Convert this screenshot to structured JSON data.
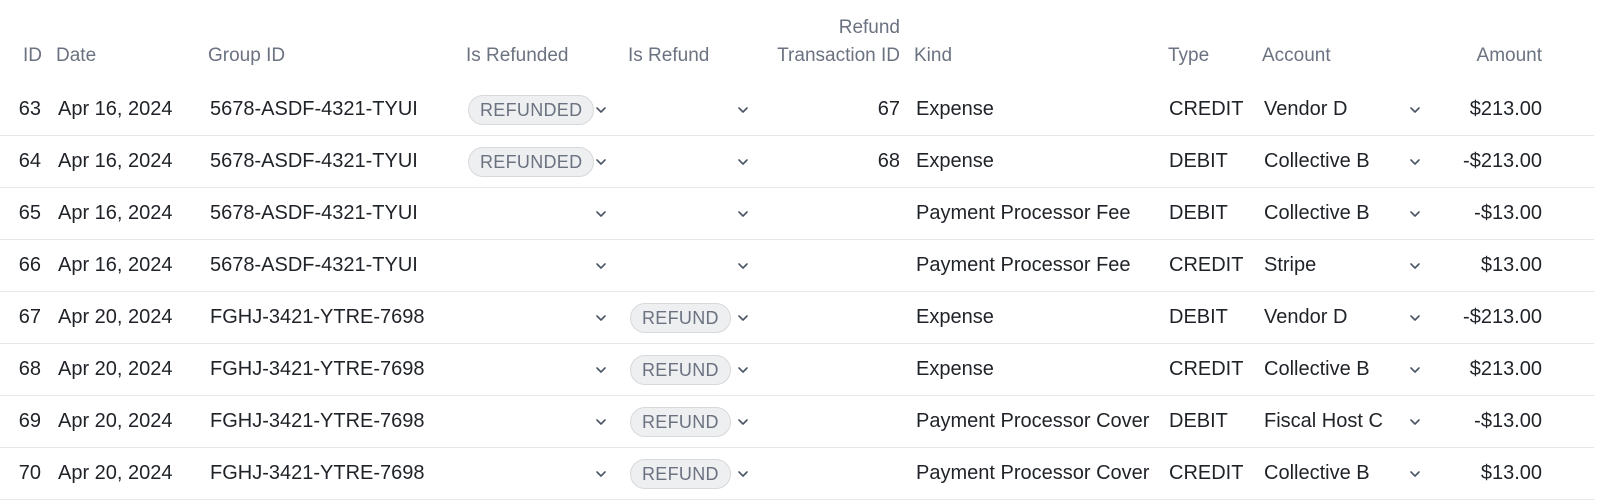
{
  "columns": {
    "id": "ID",
    "date": "Date",
    "group_id": "Group ID",
    "is_refunded": "Is Refunded",
    "is_refund": "Is Refund",
    "refund_tx_line1": "Refund",
    "refund_tx_line2": "Transaction ID",
    "kind": "Kind",
    "type": "Type",
    "account": "Account",
    "amount": "Amount"
  },
  "icons": {
    "dropdown": "chevron-down-icon"
  },
  "colors": {
    "pill_bg": "#eeeff1",
    "pill_text": "#6b7280",
    "header_text": "#6b7280",
    "divider": "#e5e7eb"
  },
  "rows": [
    {
      "id": "63",
      "date": "Apr 16, 2024",
      "group_id": "5678-ASDF-4321-TYUI",
      "is_refunded": "REFUNDED",
      "is_refund": "",
      "refund_tx": "67",
      "kind": "Expense",
      "type": "CREDIT",
      "account": "Vendor D",
      "amount": "$213.00"
    },
    {
      "id": "64",
      "date": "Apr 16, 2024",
      "group_id": "5678-ASDF-4321-TYUI",
      "is_refunded": "REFUNDED",
      "is_refund": "",
      "refund_tx": "68",
      "kind": "Expense",
      "type": "DEBIT",
      "account": "Collective B",
      "amount": "-$213.00"
    },
    {
      "id": "65",
      "date": "Apr 16, 2024",
      "group_id": "5678-ASDF-4321-TYUI",
      "is_refunded": "",
      "is_refund": "",
      "refund_tx": "",
      "kind": "Payment Processor Fee",
      "type": "DEBIT",
      "account": "Collective B",
      "amount": "-$13.00"
    },
    {
      "id": "66",
      "date": "Apr 16, 2024",
      "group_id": "5678-ASDF-4321-TYUI",
      "is_refunded": "",
      "is_refund": "",
      "refund_tx": "",
      "kind": "Payment Processor Fee",
      "type": "CREDIT",
      "account": "Stripe",
      "amount": "$13.00"
    },
    {
      "id": "67",
      "date": "Apr 20, 2024",
      "group_id": "FGHJ-3421-YTRE-7698",
      "is_refunded": "",
      "is_refund": "REFUND",
      "refund_tx": "",
      "kind": "Expense",
      "type": "DEBIT",
      "account": "Vendor D",
      "amount": "-$213.00"
    },
    {
      "id": "68",
      "date": "Apr 20, 2024",
      "group_id": "FGHJ-3421-YTRE-7698",
      "is_refunded": "",
      "is_refund": "REFUND",
      "refund_tx": "",
      "kind": "Expense",
      "type": "CREDIT",
      "account": "Collective B",
      "amount": "$213.00"
    },
    {
      "id": "69",
      "date": "Apr 20, 2024",
      "group_id": "FGHJ-3421-YTRE-7698",
      "is_refunded": "",
      "is_refund": "REFUND",
      "refund_tx": "",
      "kind": "Payment Processor Cover",
      "type": "DEBIT",
      "account": "Fiscal Host C",
      "amount": "-$13.00"
    },
    {
      "id": "70",
      "date": "Apr 20, 2024",
      "group_id": "FGHJ-3421-YTRE-7698",
      "is_refunded": "",
      "is_refund": "REFUND",
      "refund_tx": "",
      "kind": "Payment Processor Cover",
      "type": "CREDIT",
      "account": "Collective B",
      "amount": "$13.00"
    }
  ]
}
